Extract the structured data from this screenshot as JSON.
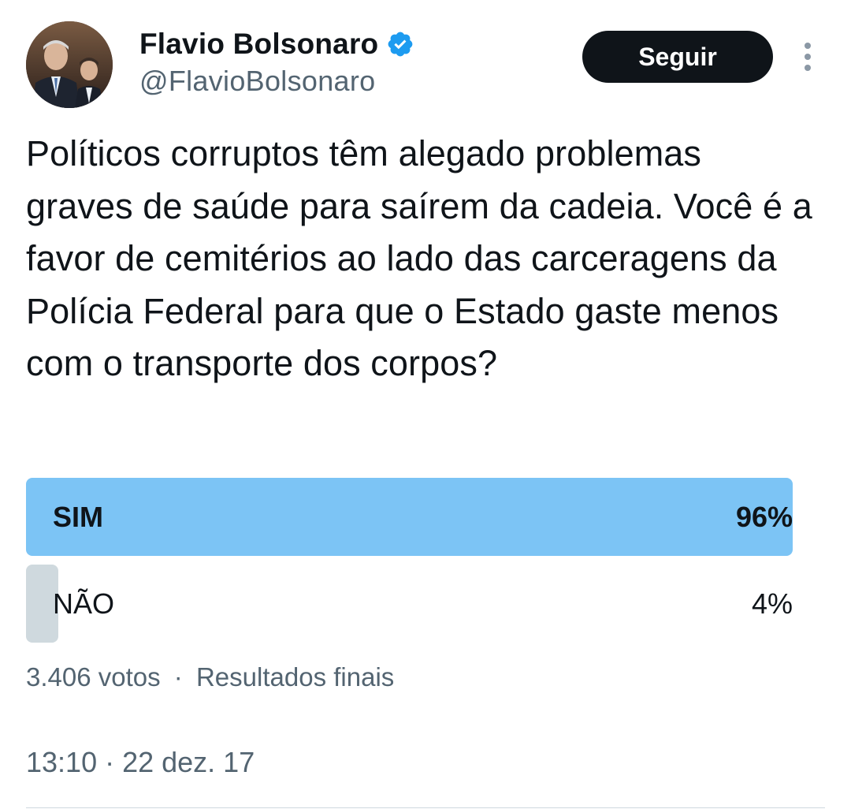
{
  "author": {
    "display_name": "Flavio Bolsonaro",
    "handle": "@FlavioBolsonaro",
    "verified": true,
    "verified_color": "#1d9bf0",
    "avatar_icon": "profile-photo"
  },
  "actions": {
    "follow_label": "Seguir",
    "more_icon": "vertical-ellipsis-icon"
  },
  "tweet": {
    "text": "Políticos corruptos têm alegado problemas graves de saúde para saírem da cadeia. Você é a favor de cemitérios ao lado das carceragens da Polícia Federal para que o Estado gaste menos com o transporte dos corpos?"
  },
  "poll": {
    "options": [
      {
        "label": "SIM",
        "percent_label": "96%",
        "share": 0.96,
        "winner": true,
        "bar_color": "#7cc4f5"
      },
      {
        "label": "NÃO",
        "percent_label": "4%",
        "share": 0.04,
        "winner": false,
        "bar_color": "#cfd9de"
      }
    ],
    "votes": "3.406 votos",
    "separator": "·",
    "status": "Resultados finais"
  },
  "meta": {
    "timestamp": "13:10 · 22 dez. 17"
  },
  "colors": {
    "text_primary": "#0f1419",
    "text_secondary": "#536471",
    "button_bg": "#0f1419",
    "button_text": "#ffffff"
  }
}
